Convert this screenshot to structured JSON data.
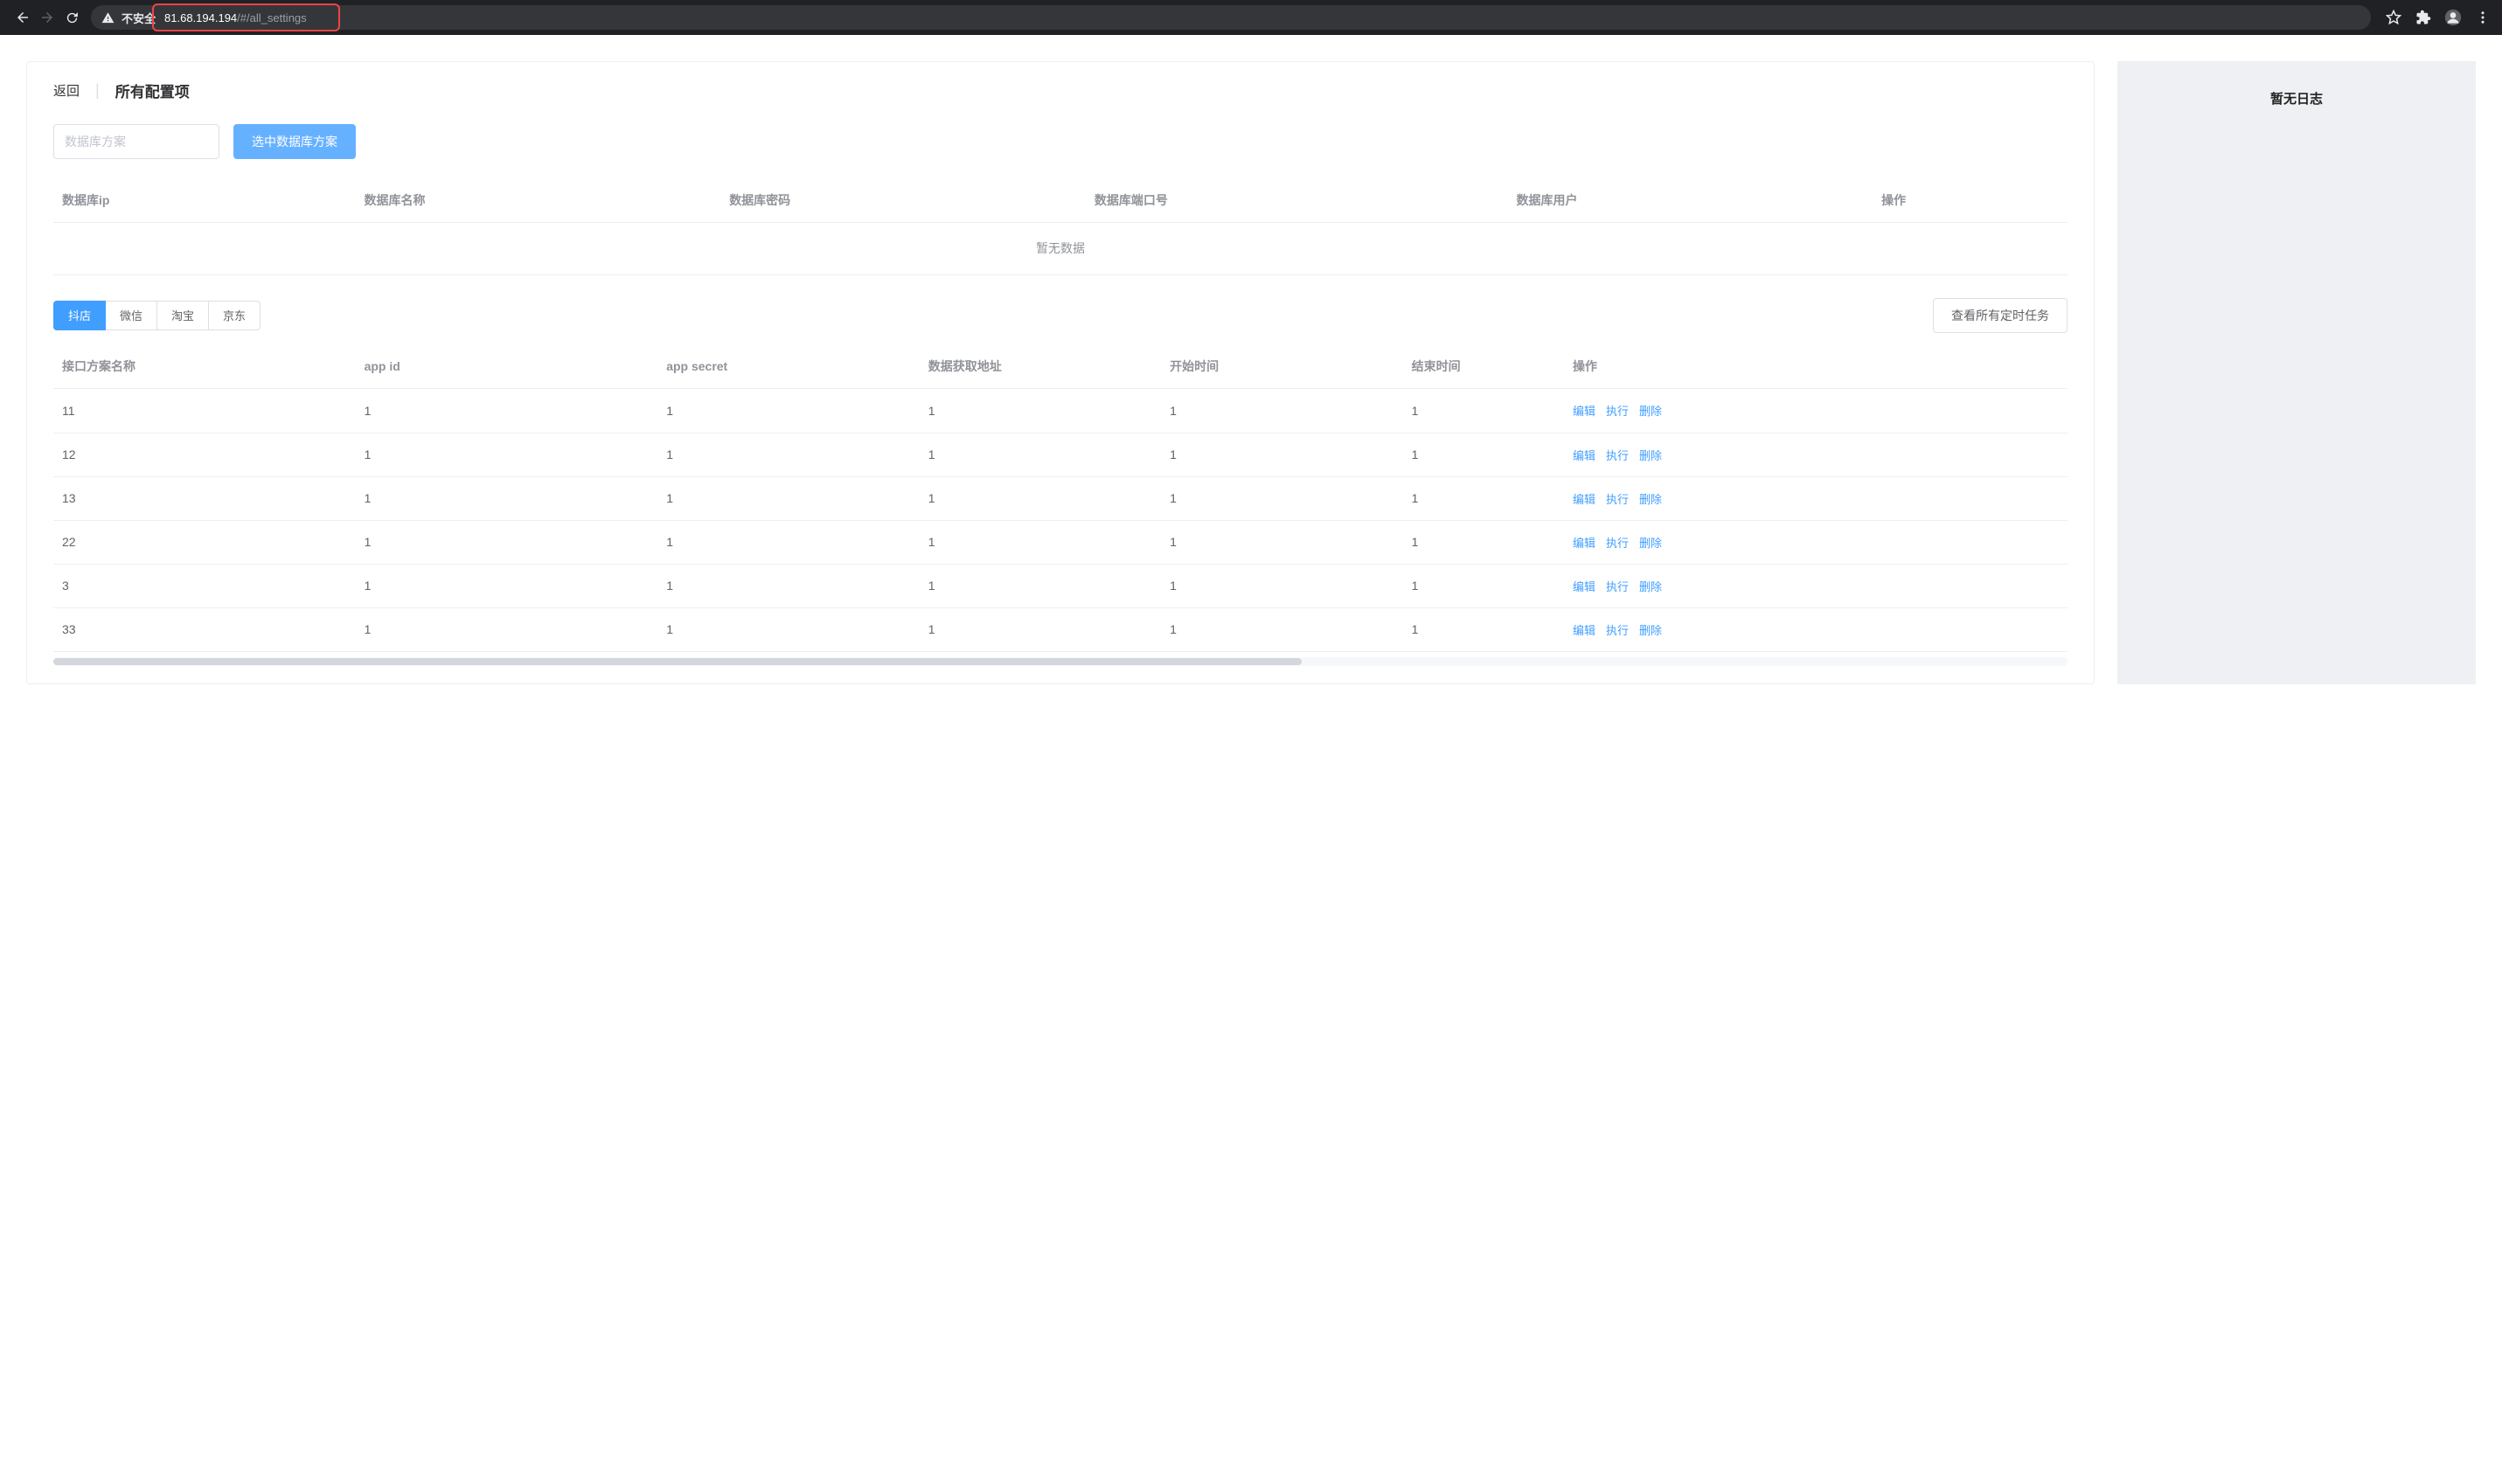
{
  "browser": {
    "not_secure_label": "不安全",
    "url_host": "81.68.194.194",
    "url_path": "/#/all_settings"
  },
  "header": {
    "back": "返回",
    "title": "所有配置项"
  },
  "toolbar": {
    "input_placeholder": "数据库方案",
    "select_btn": "选中数据库方案"
  },
  "db_table": {
    "headers": {
      "ip": "数据库ip",
      "name": "数据库名称",
      "pwd": "数据库密码",
      "port": "数据库端口号",
      "user": "数据库用户",
      "ops": "操作"
    },
    "empty": "暂无数据"
  },
  "tabs": {
    "douyin": "抖店",
    "wechat": "微信",
    "taobao": "淘宝",
    "jd": "京东"
  },
  "tabs_side_btn": "查看所有定时任务",
  "main_table": {
    "headers": {
      "name": "接口方案名称",
      "appid": "app id",
      "secret": "app secret",
      "url": "数据获取地址",
      "start": "开始时间",
      "end": "结束时间",
      "ops": "操作"
    },
    "actions": {
      "edit": "编辑",
      "run": "执行",
      "del": "删除"
    },
    "rows": [
      {
        "name": "11",
        "appid": "1",
        "secret": "1",
        "url": "1",
        "start": "1",
        "end": "1"
      },
      {
        "name": "12",
        "appid": "1",
        "secret": "1",
        "url": "1",
        "start": "1",
        "end": "1"
      },
      {
        "name": "13",
        "appid": "1",
        "secret": "1",
        "url": "1",
        "start": "1",
        "end": "1"
      },
      {
        "name": "22",
        "appid": "1",
        "secret": "1",
        "url": "1",
        "start": "1",
        "end": "1"
      },
      {
        "name": "3",
        "appid": "1",
        "secret": "1",
        "url": "1",
        "start": "1",
        "end": "1"
      },
      {
        "name": "33",
        "appid": "1",
        "secret": "1",
        "url": "1",
        "start": "1",
        "end": "1"
      }
    ]
  },
  "log_panel": {
    "empty": "暂无日志"
  }
}
